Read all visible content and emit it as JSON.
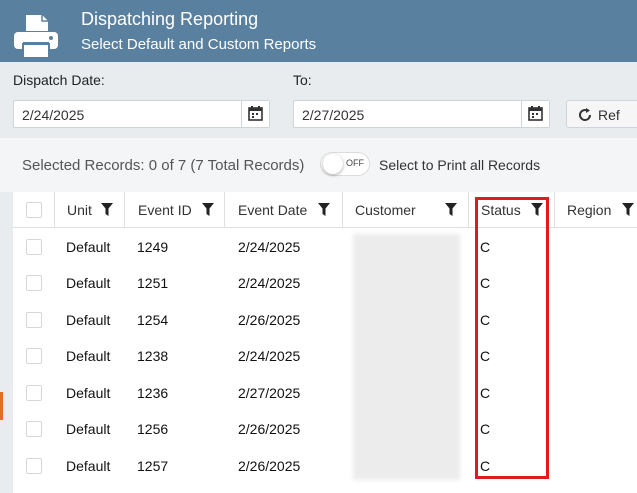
{
  "header": {
    "title": "Dispatching Reporting",
    "subtitle": "Select Default and Custom Reports",
    "icon": "printer-icon"
  },
  "filters": {
    "dispatch_date_label": "Dispatch Date:",
    "dispatch_date_value": "2/24/2025",
    "to_label": "To:",
    "to_value": "2/27/2025",
    "refresh_label": "Ref"
  },
  "selection": {
    "selected_text": "Selected Records: 0 of 7 (7 Total Records)",
    "toggle_label": "OFF",
    "print_all_label": "Select to Print all Records"
  },
  "table": {
    "columns": [
      "Unit",
      "Event ID",
      "Event Date",
      "Customer",
      "Status",
      "Region"
    ],
    "rows": [
      {
        "unit": "Default",
        "event_id": "1249",
        "event_date": "2/24/2025",
        "status": "C"
      },
      {
        "unit": "Default",
        "event_id": "1251",
        "event_date": "2/24/2025",
        "status": "C"
      },
      {
        "unit": "Default",
        "event_id": "1254",
        "event_date": "2/26/2025",
        "status": "C"
      },
      {
        "unit": "Default",
        "event_id": "1238",
        "event_date": "2/24/2025",
        "status": "C"
      },
      {
        "unit": "Default",
        "event_id": "1236",
        "event_date": "2/27/2025",
        "status": "C"
      },
      {
        "unit": "Default",
        "event_id": "1256",
        "event_date": "2/26/2025",
        "status": "C"
      },
      {
        "unit": "Default",
        "event_id": "1257",
        "event_date": "2/26/2025",
        "status": "C"
      }
    ]
  },
  "colors": {
    "header_bg": "#5a809f",
    "highlight": "#e11b1b"
  }
}
